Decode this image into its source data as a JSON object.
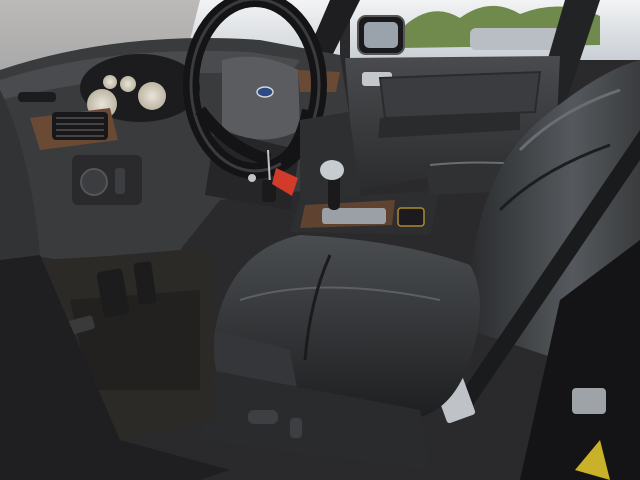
{
  "scene": {
    "subject": "car-interior-driver-side",
    "colors": {
      "leather": "#2b2d2f",
      "leather_highlight": "#6a6e72",
      "dash": "#3a3b3d",
      "wood_trim": "#6b4a35",
      "sky": "#e4e7ea",
      "foliage": "#6f8a4c",
      "door_panel": "#3f4043",
      "floor": "#2c2a27",
      "key_tag": "#d23a2a"
    }
  }
}
